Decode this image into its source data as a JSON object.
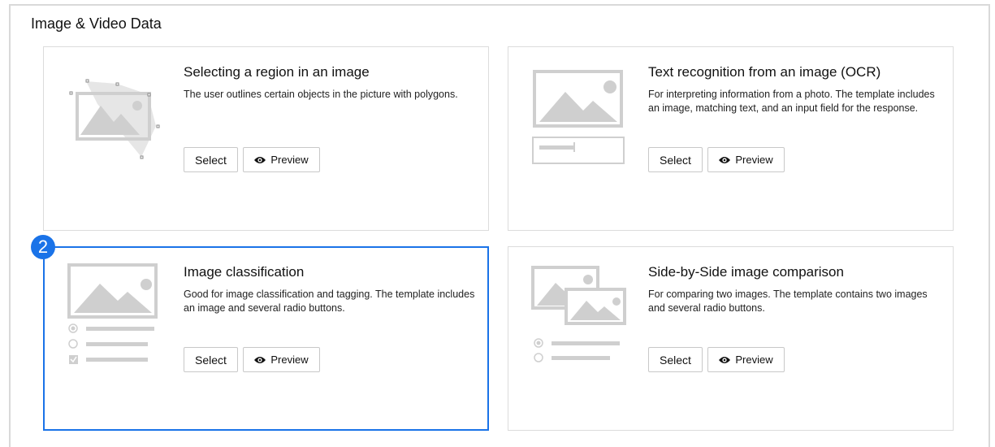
{
  "section": {
    "title": "Image & Video Data"
  },
  "cards": [
    {
      "title": "Selecting a region in an image",
      "description": "The user outlines certain objects in the picture with polygons.",
      "select_label": "Select",
      "preview_label": "Preview"
    },
    {
      "title": "Text recognition from an image (OCR)",
      "description": "For interpreting information from a photo. The template includes an image, matching text, and an input field for the response.",
      "select_label": "Select",
      "preview_label": "Preview"
    },
    {
      "title": "Image classification",
      "description": "Good for image classification and tagging. The template includes an image and several radio buttons.",
      "select_label": "Select",
      "preview_label": "Preview",
      "selected": true
    },
    {
      "title": "Side-by-Side image comparison",
      "description": "For comparing two images. The template contains two images and several radio buttons.",
      "select_label": "Select",
      "preview_label": "Preview"
    }
  ],
  "badge": {
    "number": "2"
  },
  "colors": {
    "accent": "#1a73e8",
    "illustration": "#cfcfcf",
    "border": "#dcdcdc"
  },
  "icons": {
    "preview": "eye-icon"
  }
}
